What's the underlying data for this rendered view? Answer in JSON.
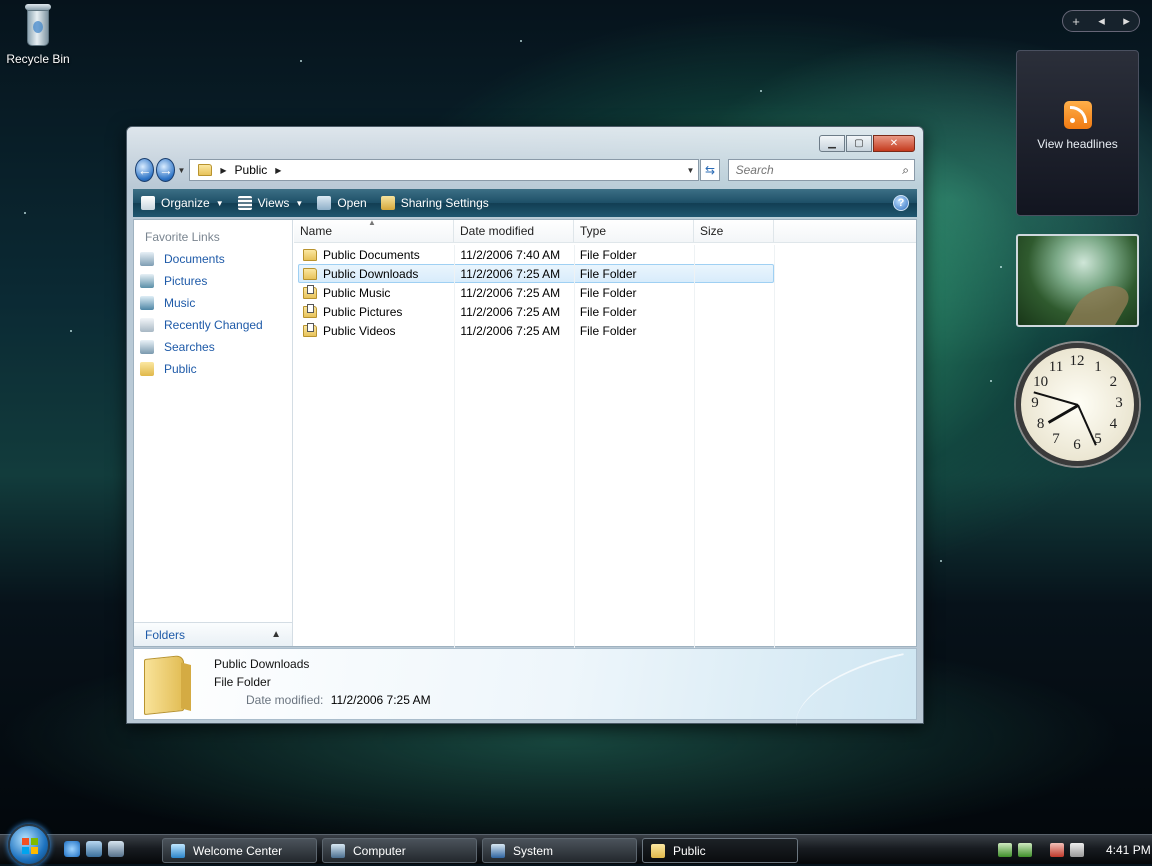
{
  "desktop": {
    "recycle_bin_label": "Recycle Bin"
  },
  "gadgets": {
    "add_symbol": "+",
    "prev_symbol": "◂",
    "next_symbol": "▸",
    "feed_label": "View headlines",
    "clock_numbers": [
      "12",
      "1",
      "2",
      "3",
      "4",
      "5",
      "6",
      "7",
      "8",
      "9",
      "10",
      "11"
    ]
  },
  "window": {
    "address": {
      "crumbs": [
        "Public"
      ]
    },
    "search": {
      "placeholder": "Search"
    },
    "toolbar": {
      "organize": "Organize",
      "views": "Views",
      "open": "Open",
      "sharing": "Sharing Settings",
      "help_symbol": "?"
    },
    "nav_pane": {
      "title": "Favorite Links",
      "links": [
        "Documents",
        "Pictures",
        "Music",
        "Recently Changed",
        "Searches",
        "Public"
      ],
      "folders_label": "Folders"
    },
    "columns": [
      "Name",
      "Date modified",
      "Type",
      "Size"
    ],
    "rows": [
      {
        "name": "Public Documents",
        "date": "11/2/2006 7:40 AM",
        "type": "File Folder",
        "size": ""
      },
      {
        "name": "Public Downloads",
        "date": "11/2/2006 7:25 AM",
        "type": "File Folder",
        "size": ""
      },
      {
        "name": "Public Music",
        "date": "11/2/2006 7:25 AM",
        "type": "File Folder",
        "size": ""
      },
      {
        "name": "Public Pictures",
        "date": "11/2/2006 7:25 AM",
        "type": "File Folder",
        "size": ""
      },
      {
        "name": "Public Videos",
        "date": "11/2/2006 7:25 AM",
        "type": "File Folder",
        "size": ""
      }
    ],
    "selected_row": 1,
    "details": {
      "name": "Public Downloads",
      "type": "File Folder",
      "modified_label": "Date modified:",
      "modified_value": "11/2/2006 7:25 AM"
    }
  },
  "taskbar": {
    "tasks": [
      "Welcome Center",
      "Computer",
      "System",
      "Public"
    ],
    "active_task": 3,
    "time": "4:41 PM"
  },
  "colors": {
    "accent": "#1e5aa8",
    "toolbar": "#1d4f67",
    "selection": "#d8ecfb"
  }
}
